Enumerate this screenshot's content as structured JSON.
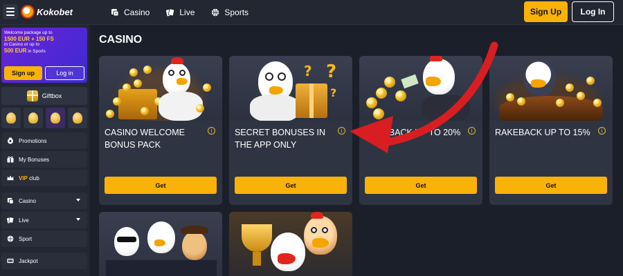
{
  "header": {
    "logo_text": "Kokobet",
    "nav": [
      {
        "label": "Casino",
        "icon": "dice-icon"
      },
      {
        "label": "Live",
        "icon": "cards-icon"
      },
      {
        "label": "Sports",
        "icon": "ball-icon"
      }
    ],
    "signup_label": "Sign Up",
    "login_label": "Log In"
  },
  "sidebar": {
    "promo": {
      "line1": "Welcome package up to",
      "amount1": "1500 EUR + 150 FS",
      "line2": "in Casino or up to",
      "amount2": "500 EUR",
      "line3": "in Sports",
      "signup_label": "Sign up",
      "login_label": "Log in"
    },
    "giftbox_label": "Giftbox",
    "items": [
      {
        "label": "Promotions",
        "icon": "promotions-icon"
      },
      {
        "label": "My Bonuses",
        "icon": "gift-icon"
      },
      {
        "label": "VIP club",
        "prefix": "VIP",
        "suffix": " club",
        "icon": "crown-icon"
      },
      {
        "label": "Casino",
        "icon": "dice-icon",
        "expandable": true
      },
      {
        "label": "Live",
        "icon": "cards-icon",
        "expandable": true
      },
      {
        "label": "Sport",
        "icon": "ball-icon"
      },
      {
        "label": "Jackpot",
        "icon": "jackpot-icon"
      }
    ]
  },
  "main": {
    "title": "CASINO",
    "cards": [
      {
        "title": "CASINO WELCOME BONUS PACK",
        "button": "Get"
      },
      {
        "title": "SECRET BONUSES IN THE APP ONLY",
        "button": "Get"
      },
      {
        "title": "CASHBACK UP TO 20%",
        "title_visible": "...ACK UP TO 20...",
        "button": "Get"
      },
      {
        "title": "RAKEBACK UP TO 15%",
        "button": "Get"
      }
    ]
  },
  "colors": {
    "accent": "#f9b208",
    "background": "#1b1f2a",
    "panel": "#232732",
    "card": "#2f3442",
    "promo": "#5b25d4",
    "arrow": "#d81e22"
  }
}
